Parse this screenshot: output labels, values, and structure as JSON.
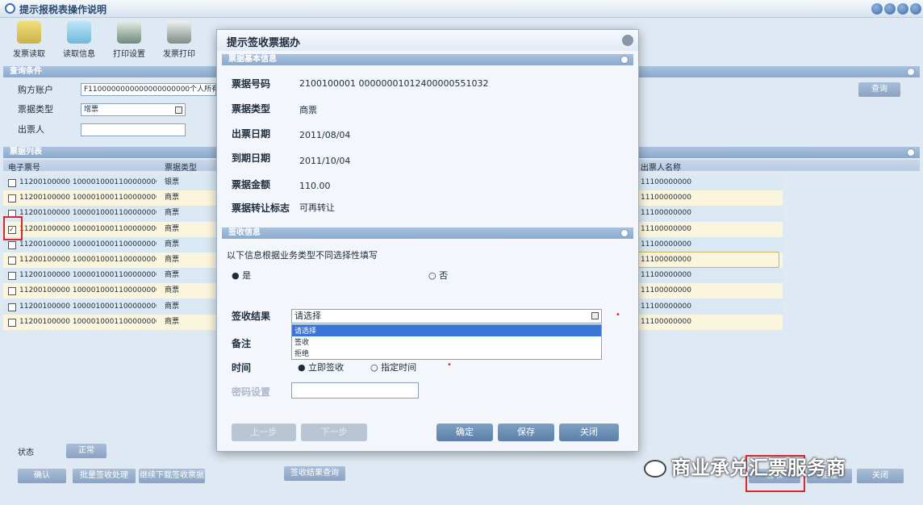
{
  "window": {
    "title": "提示报税表操作说明"
  },
  "toolbar": [
    {
      "label": "发票读取",
      "icon": "folder-icon"
    },
    {
      "label": "读取信息",
      "icon": "document-icon"
    },
    {
      "label": "打印设置",
      "icon": "printer-icon"
    },
    {
      "label": "发票打印",
      "icon": "printer-icon"
    }
  ],
  "query": {
    "section": "查询条件",
    "fields": [
      {
        "label": "购方账户",
        "value": "F1100000000000000000000个人所有人名称"
      },
      {
        "label": "票据类型",
        "value": "增票"
      },
      {
        "label": "出票人",
        "value": ""
      }
    ],
    "search_button": "查询"
  },
  "list": {
    "section": "票据列表",
    "headers": [
      "电子票号",
      "票据类型",
      "出票人名称"
    ],
    "rows": [
      {
        "no": "11200100000 1000010001100000000000",
        "type": "银票",
        "payee": "11100000000"
      },
      {
        "no": "11200100000 1000010001100000000000",
        "type": "商票",
        "payee": "11100000000"
      },
      {
        "no": "11200100000 1000010001100000000000",
        "type": "商票",
        "payee": "11100000000"
      },
      {
        "no": "11200100000 1000010001100000000000",
        "type": "商票",
        "payee": "11100000000"
      },
      {
        "no": "11200100000 1000010001100000000000",
        "type": "商票",
        "payee": "11100000000"
      },
      {
        "no": "11200100000 1000010001100000000000",
        "type": "商票",
        "payee": "11100000000"
      },
      {
        "no": "11200100000 1000010001100000000000",
        "type": "商票",
        "payee": "11100000000"
      },
      {
        "no": "11200100000 1000010001100000000000",
        "type": "商票",
        "payee": "11100000000"
      },
      {
        "no": "11200100000 1000010001100000000000",
        "type": "商票",
        "payee": "11100000000"
      },
      {
        "no": "11200100000 1000010001100000000000",
        "type": "商票",
        "payee": "11100000000"
      }
    ]
  },
  "dialog": {
    "title": "提示签收票据办",
    "section1": "票据基本信息",
    "fields": [
      {
        "label": "票据号码",
        "value": "2100100001 00000001012400000551032"
      },
      {
        "label": "票据类型",
        "value": "商票"
      },
      {
        "label": "出票日期",
        "value": "2011/08/04"
      },
      {
        "label": "到期日期",
        "value": "2011/10/04"
      },
      {
        "label": "票据金额",
        "value": "110.00"
      },
      {
        "label": "票据转让标志",
        "value": "可再转让"
      }
    ],
    "section2": "签收信息",
    "notice": "以下信息根据业务类型不同选择性填写",
    "radio_yes": "是",
    "radio_no": "否",
    "result_label": "签收结果",
    "result_value": "请选择",
    "dropdown_options": [
      "请选择",
      "签收",
      "拒绝"
    ],
    "remark_label": "备注",
    "time_label": "时间",
    "time_opt1": "立即签收",
    "time_opt2": "指定时间",
    "password_label": "密码设置",
    "buttons": {
      "b1": "上一步",
      "b2": "下一步",
      "confirm": "确定",
      "save": "保存",
      "close": "关闭"
    }
  },
  "bottom": {
    "status_label": "状态",
    "status_value": "正常",
    "buttons": [
      "确认",
      "批量签收处理",
      "继续下载签收票据"
    ],
    "center_button": "签收结果查询",
    "right_buttons": [
      "签收",
      "拒签",
      "关闭"
    ]
  },
  "watermark": "商业承兑汇票服务商"
}
